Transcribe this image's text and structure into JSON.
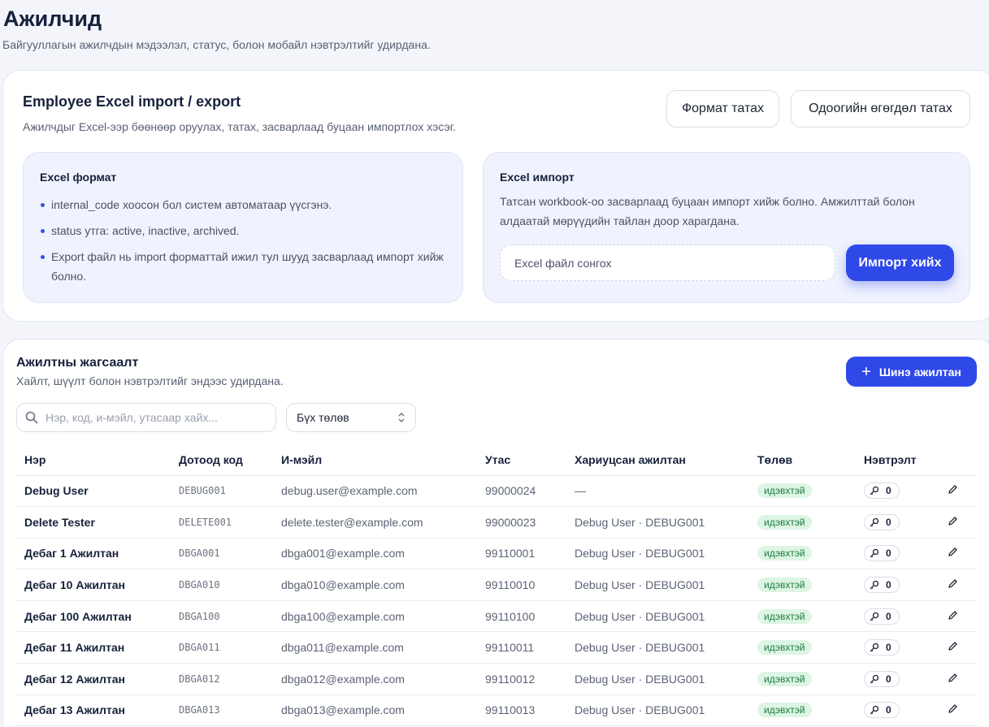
{
  "page": {
    "title": "Ажилчид",
    "subtitle": "Байгууллагын ажилчдын мэдээлэл, статус, болон мобайл нэвтрэлтийг удирдана."
  },
  "import_export": {
    "title": "Employee Excel import / export",
    "description": "Ажилчдыг Excel-ээр бөөнөөр оруулах, татах, засварлаад буцаан импортлох хэсэг.",
    "download_format_label": "Формат татах",
    "download_current_label": "Одоогийн өгөгдөл татах",
    "format_panel": {
      "title": "Excel формат",
      "bullets": [
        "internal_code хоосон бол систем автоматаар үүсгэнэ.",
        "status утга: active, inactive, archived.",
        "Export файл нь import форматтай ижил тул шууд засварлаад импорт хийж болно."
      ]
    },
    "import_panel": {
      "title": "Excel импорт",
      "description": "Татсан workbook-оо засварлаад буцаан импорт хийж болно. Амжилттай болон алдаатай мөрүүдийн тайлан доор харагдана.",
      "file_placeholder": "Excel файл сонгох",
      "import_button_label": "Импорт хийх"
    }
  },
  "employee_list": {
    "title": "Ажилтны жагсаалт",
    "description": "Хайлт, шүүлт болон нэвтрэлтийг эндээс удирдана.",
    "new_button_label": "Шинэ ажилтан",
    "search_placeholder": "Нэр, код, и-мэйл, утасаар хайх...",
    "status_filter": "Бүх төлөв",
    "columns": [
      "Нэр",
      "Дотоод код",
      "И-мэйл",
      "Утас",
      "Хариуцсан ажилтан",
      "Төлөв",
      "Нэвтрэлт"
    ],
    "rows": [
      {
        "name": "Debug User",
        "code": "DEBUG001",
        "email": "debug.user@example.com",
        "phone": "99000024",
        "manager": "—",
        "status": "идэвхтэй",
        "access": "0"
      },
      {
        "name": "Delete Tester",
        "code": "DELETE001",
        "email": "delete.tester@example.com",
        "phone": "99000023",
        "manager": "Debug User · DEBUG001",
        "status": "идэвхтэй",
        "access": "0"
      },
      {
        "name": "Дебаг 1 Ажилтан",
        "code": "DBGA001",
        "email": "dbga001@example.com",
        "phone": "99110001",
        "manager": "Debug User · DEBUG001",
        "status": "идэвхтэй",
        "access": "0"
      },
      {
        "name": "Дебаг 10 Ажилтан",
        "code": "DBGA010",
        "email": "dbga010@example.com",
        "phone": "99110010",
        "manager": "Debug User · DEBUG001",
        "status": "идэвхтэй",
        "access": "0"
      },
      {
        "name": "Дебаг 100 Ажилтан",
        "code": "DBGA100",
        "email": "dbga100@example.com",
        "phone": "99110100",
        "manager": "Debug User · DEBUG001",
        "status": "идэвхтэй",
        "access": "0"
      },
      {
        "name": "Дебаг 11 Ажилтан",
        "code": "DBGA011",
        "email": "dbga011@example.com",
        "phone": "99110011",
        "manager": "Debug User · DEBUG001",
        "status": "идэвхтэй",
        "access": "0"
      },
      {
        "name": "Дебаг 12 Ажилтан",
        "code": "DBGA012",
        "email": "dbga012@example.com",
        "phone": "99110012",
        "manager": "Debug User · DEBUG001",
        "status": "идэвхтэй",
        "access": "0"
      },
      {
        "name": "Дебаг 13 Ажилтан",
        "code": "DBGA013",
        "email": "dbga013@example.com",
        "phone": "99110013",
        "manager": "Debug User · DEBUG001",
        "status": "идэвхтэй",
        "access": "0"
      }
    ]
  },
  "icons": {
    "search": "search-icon",
    "select_arrows": "chevron-up-down-icon",
    "plus": "plus-icon",
    "access": "key-icon",
    "edit": "pencil-icon"
  },
  "colors": {
    "primary": "#2f49e8",
    "badge_bg": "#dcf5e4",
    "badge_text": "#207a42",
    "title": "#16213b"
  }
}
